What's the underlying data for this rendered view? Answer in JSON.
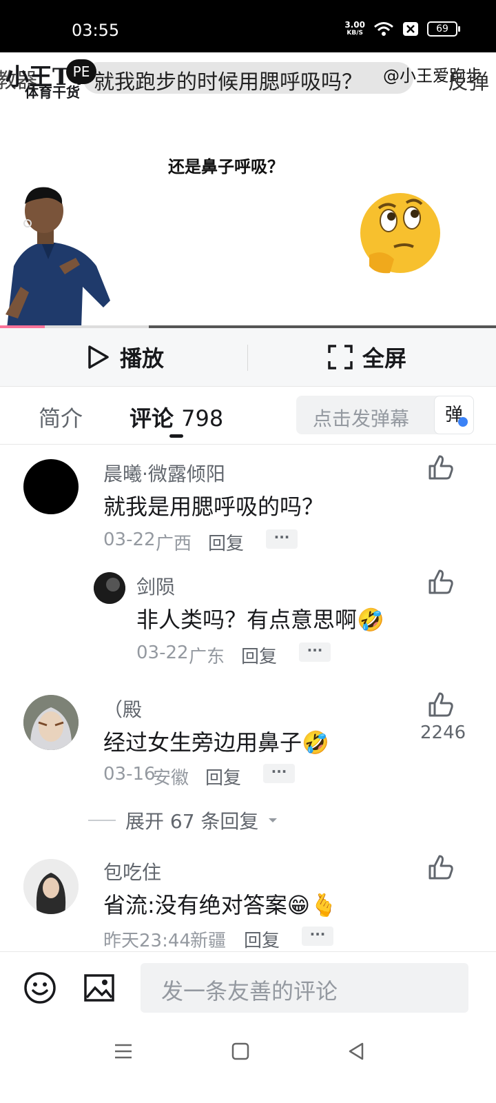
{
  "status": {
    "time": "03:55",
    "net_speed_value": "3.00",
    "net_speed_unit": "KB/S",
    "battery": "69"
  },
  "video": {
    "logo_main": "小王TV",
    "logo_sub": "体育干货",
    "logo_badge": "PE",
    "danmaku_left": "教器",
    "danmaku_text": "就我跑步的时候用腮呼吸吗？",
    "danmaku_user": "@小王爱跑步",
    "danmaku_side": "反弹",
    "caption": "还是鼻子呼吸？",
    "progress_fraction": 0.09,
    "buffer_fraction": 0.3
  },
  "controls": {
    "play_label": "播放",
    "fullscreen_label": "全屏"
  },
  "tabs": {
    "intro_label": "简介",
    "comments_label": "评论",
    "comments_count": "798",
    "danmaku_placeholder": "点击发弹幕",
    "danmaku_button": "弹"
  },
  "comments": [
    {
      "user": "晨曦·微露倾阳",
      "text": "就我是用腮呼吸的吗？",
      "date": "03-22",
      "location": "广西",
      "reply": "回复",
      "more": "···"
    },
    {
      "user": "剑陨",
      "text": "非人类吗？有点意思啊",
      "emoji": "🤣",
      "date": "03-22",
      "location": "广东",
      "reply": "回复",
      "more": "···"
    },
    {
      "user": "（殿",
      "text": "经过女生旁边用鼻子",
      "emoji": "🤣",
      "date": "03-16",
      "location": "安徽",
      "reply": "回复",
      "more": "···",
      "likes": "2246"
    },
    {
      "user": "包吃住",
      "text": "省流:没有绝对答案",
      "emoji": "😁🫰",
      "date": "昨天23:44",
      "location": "新疆",
      "reply": "回复",
      "more": "···"
    }
  ],
  "expand_replies": "展开 67 条回复",
  "bottom": {
    "comment_placeholder": "发一条友善的评论"
  },
  "colors": {
    "accent_pink": "#fb7299",
    "text_primary": "#18191c",
    "text_secondary": "#61666d",
    "text_muted": "#9499a0"
  },
  "icons": [
    "play-icon",
    "fullscreen-icon",
    "like-icon",
    "emoji-icon",
    "image-icon",
    "menu-icon",
    "home-icon",
    "back-icon"
  ]
}
